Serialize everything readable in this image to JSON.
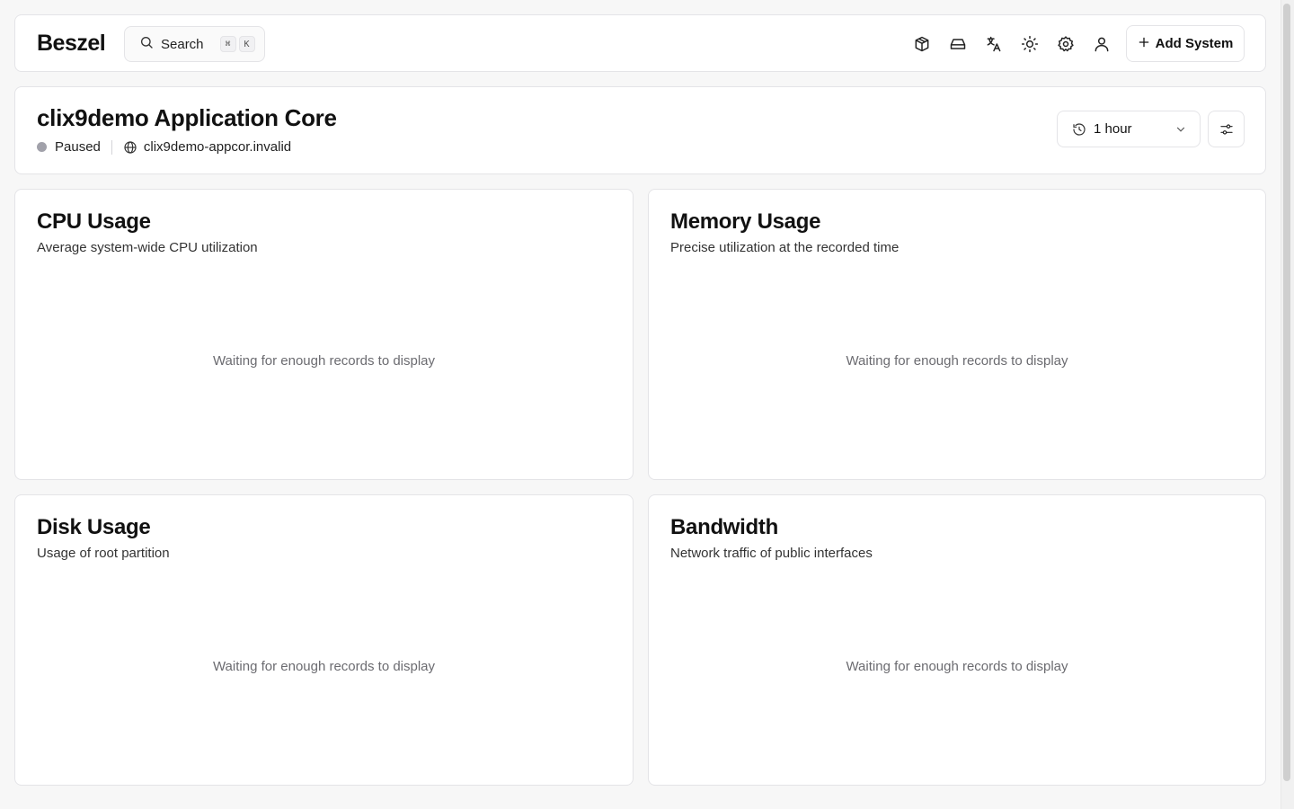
{
  "header": {
    "logo": "Beszel",
    "search": {
      "label": "Search",
      "kbd": [
        "⌘",
        "K"
      ]
    },
    "icons": [
      "containers-icon",
      "drive-icon",
      "translate-icon",
      "sun-icon",
      "gear-icon",
      "user-icon"
    ],
    "add_system_label": "Add System"
  },
  "system": {
    "name": "clix9demo Application Core",
    "status": "Paused",
    "status_color": "#a1a1aa",
    "host": "clix9demo-appcor.invalid",
    "time_range": "1 hour"
  },
  "charts": [
    {
      "title": "CPU Usage",
      "subtitle": "Average system-wide CPU utilization",
      "empty": "Waiting for enough records to display"
    },
    {
      "title": "Memory Usage",
      "subtitle": "Precise utilization at the recorded time",
      "empty": "Waiting for enough records to display"
    },
    {
      "title": "Disk Usage",
      "subtitle": "Usage of root partition",
      "empty": "Waiting for enough records to display"
    },
    {
      "title": "Bandwidth",
      "subtitle": "Network traffic of public interfaces",
      "empty": "Waiting for enough records to display"
    }
  ]
}
